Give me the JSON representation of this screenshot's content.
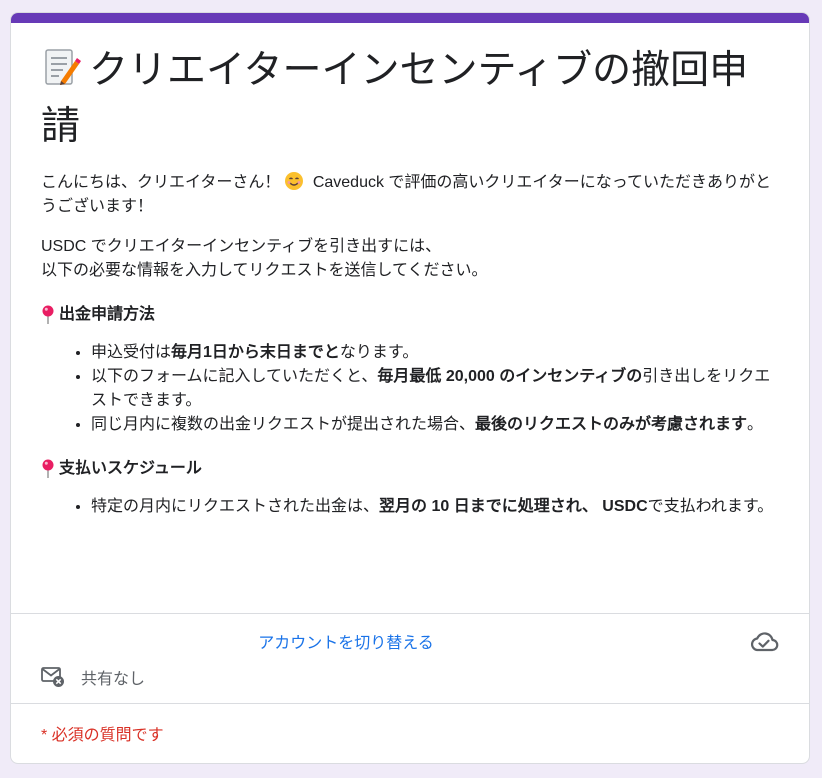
{
  "form": {
    "title": "クリエイターインセンティブの撤回申請",
    "intro_part1": "こんにちは、クリエイターさん！",
    "intro_part2": " Caveduck で評価の高いクリエイターになっていただきありがとうございます！",
    "usdc_line1": "USDC でクリエイターインセンティブを引き出すには、",
    "usdc_line2": "以下の必要な情報を入力してリクエストを送信してください。",
    "section1": {
      "heading": "出金申請方法",
      "items": [
        {
          "a": "申込受付は",
          "b": "毎月1日から末日までと",
          "c": "なります。"
        },
        {
          "a": "以下のフォームに記入していただくと、",
          "b": "毎月最低 20,000 のインセンティブの",
          "c": "引き出しをリクエストできます。"
        },
        {
          "a": "同じ月内に複数の出金リクエストが提出された場合、",
          "b": "最後のリクエストのみが考慮されます",
          "c": "。"
        }
      ]
    },
    "section2": {
      "heading": "支払いスケジュール",
      "items": [
        {
          "a": "特定の月内にリクエストされた出金は、",
          "b": "翌月の 10 日までに処理され、 USDC",
          "c": "で支払われます。"
        }
      ]
    },
    "switch_account": "アカウントを切り替える",
    "share_status": "共有なし",
    "required_note": "* 必須の質問です"
  },
  "icons": {
    "title_icon": "memo-icon",
    "intro_icon": "smiling-face-icon",
    "section_icon": "pushpin-icon",
    "saved_icon": "cloud-check-icon",
    "share_icon": "mail-off-icon"
  },
  "colors": {
    "accent": "#673ab7",
    "background": "#f0ebf8",
    "link": "#1a73e8",
    "required": "#d93025"
  }
}
